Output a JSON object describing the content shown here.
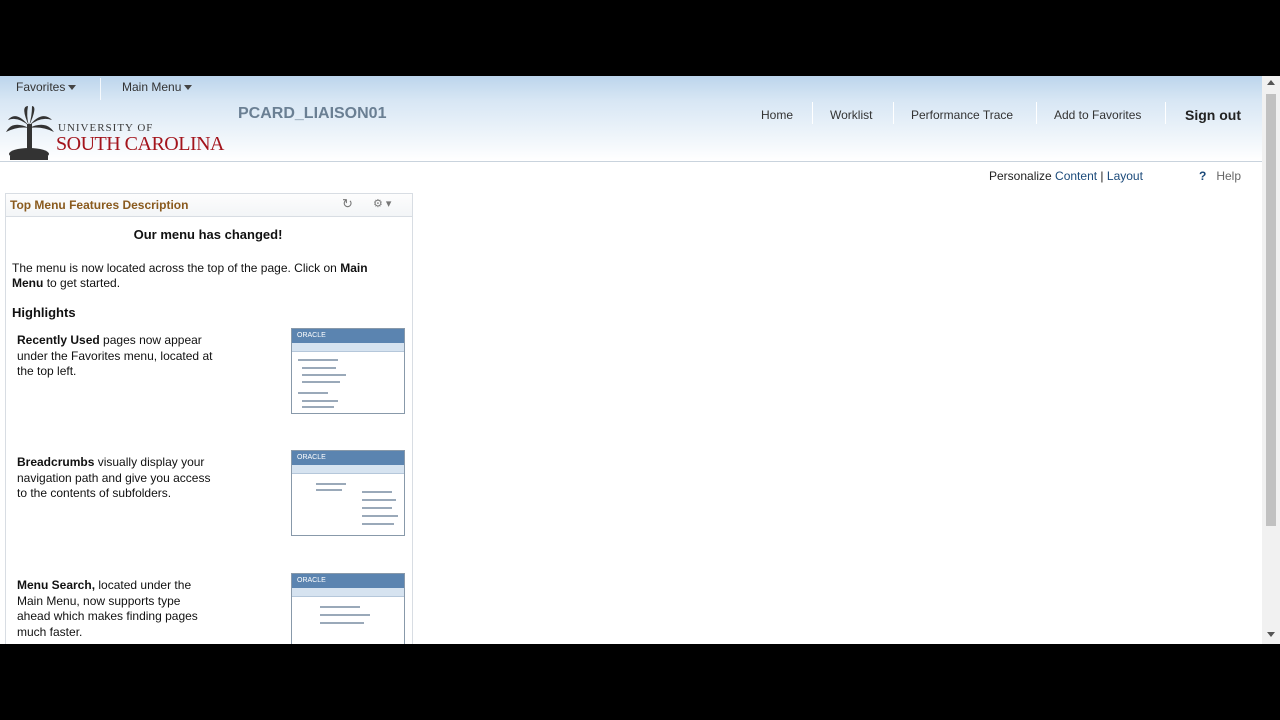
{
  "menubar": {
    "favorites": "Favorites",
    "main_menu": "Main Menu"
  },
  "logo": {
    "line1": "UNIVERSITY OF",
    "line2": "SOUTH CAROLINA"
  },
  "user_id": "PCARD_LIAISON01",
  "top_links": {
    "home": "Home",
    "worklist": "Worklist",
    "performance_trace": "Performance Trace",
    "add_to_favorites": "Add to Favorites",
    "sign_out": "Sign out"
  },
  "personalize": {
    "label": "Personalize",
    "content": "Content",
    "separator": "|",
    "layout": "Layout"
  },
  "help": {
    "icon": "?",
    "label": "Help"
  },
  "pagelet": {
    "title": "Top Menu Features Description",
    "heading": "Our menu has changed!",
    "intro_pre": "The menu is now located across the top of the page. Click on",
    "intro_bold": "Main Menu",
    "intro_post": "to get started.",
    "highlights": "Highlights",
    "features": [
      {
        "bold": "Recently Used",
        "text": "pages now appear under the Favorites menu, located at the top left.",
        "thumb_label": "ORACLE"
      },
      {
        "bold": "Breadcrumbs",
        "text": "visually display your navigation path and give you access to the contents of subfolders.",
        "thumb_label": "ORACLE"
      },
      {
        "bold": "Menu Search,",
        "text": "located under the Main Menu, now supports type ahead which makes finding pages much faster.",
        "thumb_label": "ORACLE"
      }
    ]
  },
  "colors": {
    "header_top": "#bcd5ec",
    "pagelet_title": "#8a5a1e",
    "logo_red": "#a3141c",
    "link": "#1b4a7a"
  }
}
